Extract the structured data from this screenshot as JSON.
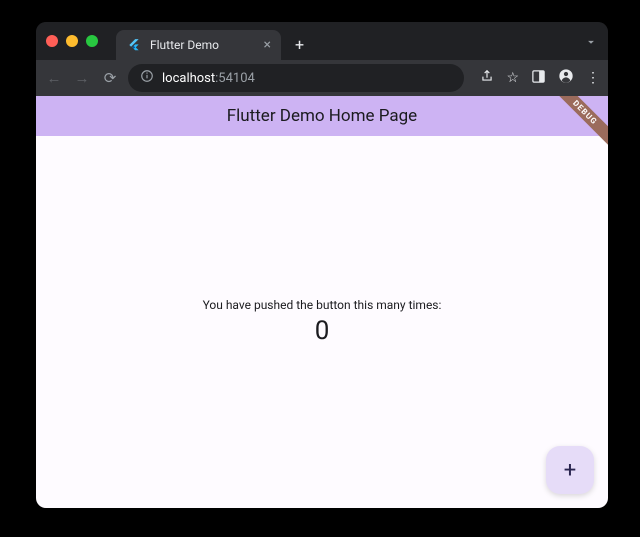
{
  "browser": {
    "tab_title": "Flutter Demo",
    "url_host": "localhost",
    "url_port": ":54104"
  },
  "app": {
    "appbar_title": "Flutter Demo Home Page",
    "debug_label": "DEBUG",
    "body_text": "You have pushed the button this many times:",
    "counter": "0",
    "fab_glyph": "+"
  }
}
